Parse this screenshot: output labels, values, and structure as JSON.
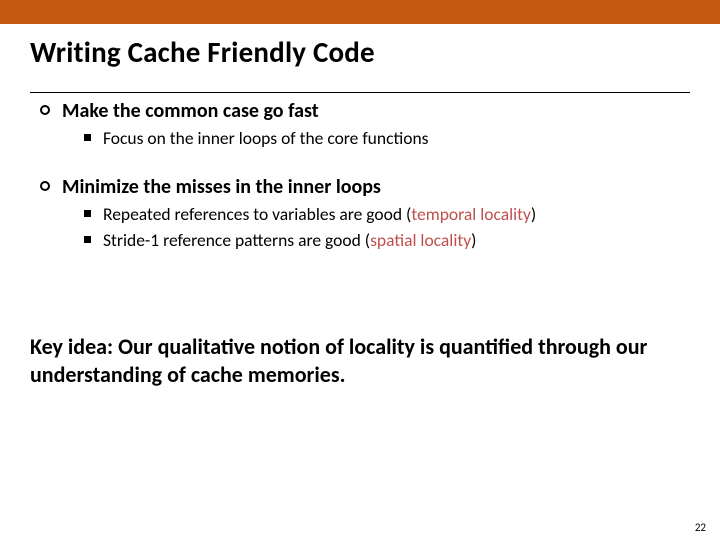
{
  "colors": {
    "accent": "#c55a11",
    "highlight": "#c0504d"
  },
  "title": "Writing Cache Friendly Code",
  "bullets": {
    "b1": "Make the common case go fast",
    "b1_sub1": "Focus on the inner loops of the core functions",
    "b2": "Minimize the misses in the inner loops",
    "b2_sub1_pre": "Repeated references to variables are good (",
    "b2_sub1_hi": "temporal locality",
    "b2_sub1_post": ")",
    "b2_sub2_pre": "Stride-1 reference patterns are good (",
    "b2_sub2_hi": "spatial locality",
    "b2_sub2_post": ")"
  },
  "key_idea": "Key idea: Our qualitative notion of locality is quantified through our understanding of cache memories.",
  "page_number": "22"
}
